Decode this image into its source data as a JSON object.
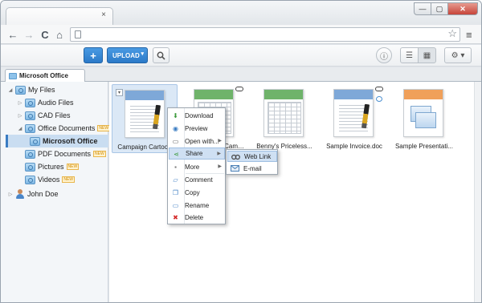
{
  "browser": {
    "tab_close": "×",
    "window_buttons": {
      "minimize": "—",
      "maximize": "▢",
      "close": "✕"
    },
    "nav": {
      "back": "←",
      "forward": "→",
      "reload": "C",
      "home": "⌂",
      "star": "☆",
      "menu": "≡"
    },
    "url": ""
  },
  "toolbar": {
    "add_label": "+",
    "upload_label": "UPLOAD",
    "upload_caret": "▾",
    "search_icon": "search-icon",
    "info_label": "ⓘ",
    "list_view": "☰",
    "grid_view": "▦",
    "settings_label": "⚙ ▾"
  },
  "panel_tab": {
    "label": "Microsoft Office"
  },
  "sidebar": {
    "items": [
      {
        "label": "My Files",
        "arrow": "◢",
        "new": ""
      },
      {
        "label": "Audio Files",
        "arrow": "▷",
        "new": ""
      },
      {
        "label": "CAD Files",
        "arrow": "▷",
        "new": ""
      },
      {
        "label": "Office Documents",
        "arrow": "◢",
        "new": "NEW"
      },
      {
        "label": "Microsoft Office",
        "arrow": "",
        "new": ""
      },
      {
        "label": "PDF Documents",
        "arrow": "",
        "new": "NEW"
      },
      {
        "label": "Pictures",
        "arrow": "",
        "new": "NEW"
      },
      {
        "label": "Videos",
        "arrow": "",
        "new": "NEW"
      },
      {
        "label": "John Doe",
        "arrow": "▷",
        "new": ""
      }
    ]
  },
  "files": [
    {
      "name": "Campaign Cartoon",
      "type": "doc-blue",
      "selected": true,
      "check": "▾"
    },
    {
      "name": "Cam…",
      "type": "sheet-green",
      "selected": false
    },
    {
      "name": "Benny's Priceless...",
      "type": "sheet-green",
      "selected": false
    },
    {
      "name": "Sample Invoice.doc",
      "type": "doc-blue",
      "selected": false
    },
    {
      "name": "Sample Presentati...",
      "type": "ppt-orange",
      "selected": false
    }
  ],
  "context_menu": {
    "items": [
      {
        "label": "Download",
        "icon": "download-icon",
        "glyph": "⬇"
      },
      {
        "label": "Preview",
        "icon": "eye-icon",
        "glyph": "◉"
      },
      {
        "label": "Open with...",
        "icon": "window-icon",
        "glyph": "▭"
      },
      {
        "label": "Share",
        "icon": "share-icon",
        "glyph": "⋖"
      },
      {
        "label": "More",
        "icon": "more-icon",
        "glyph": "▪"
      },
      {
        "label": "Comment",
        "icon": "comment-icon",
        "glyph": "▱"
      },
      {
        "label": "Copy",
        "icon": "copy-icon",
        "glyph": "❐"
      },
      {
        "label": "Rename",
        "icon": "rename-icon",
        "glyph": "▭"
      },
      {
        "label": "Delete",
        "icon": "delete-icon",
        "glyph": "✖"
      }
    ],
    "submenu_arrow": "▶"
  },
  "share_submenu": {
    "items": [
      {
        "label": "Web Link",
        "icon": "link-icon"
      },
      {
        "label": "E-mail",
        "icon": "email-icon"
      }
    ]
  },
  "colors": {
    "accent": "#2b79c8",
    "selection": "#dbe8f6",
    "delete_red": "#d42a2a"
  }
}
